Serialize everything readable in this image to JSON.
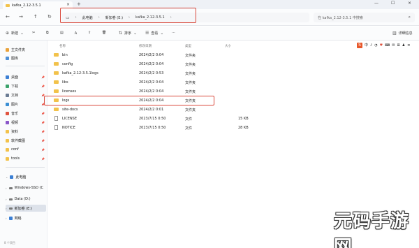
{
  "window": {
    "tab_title": "kafka_2.12-3.5.1",
    "close_glyph": "×",
    "new_tab_glyph": "+",
    "minimize_glyph": "—",
    "maximize_glyph": "☐",
    "win_close_glyph": "×"
  },
  "nav": {
    "back": "←",
    "forward": "→",
    "up": "↑",
    "refresh": "↻"
  },
  "address": {
    "crumbs": [
      "此电脑",
      "新加卷 (E:)",
      "kafka_2.12-3.5.1"
    ],
    "separator": "›",
    "search_placeholder": "在 kafka_2.12-3.5.1 中搜索"
  },
  "toolbar": {
    "new_label": "新建",
    "sort_label": "排序",
    "view_label": "查看",
    "more_label": "···",
    "details_label": "详细信息"
  },
  "sidebar": {
    "items": [
      {
        "label": "主文件夹",
        "color": "#e9a23b"
      },
      {
        "label": "图库",
        "color": "#4d8fd6"
      },
      {
        "label": "桌面",
        "color": "#3b7fd4"
      },
      {
        "label": "下载",
        "color": "#3aa26a"
      },
      {
        "label": "文档",
        "color": "#6a7b93"
      },
      {
        "label": "图片",
        "color": "#3b8fd4"
      },
      {
        "label": "音乐",
        "color": "#e0533f"
      },
      {
        "label": "视频",
        "color": "#8a56c9"
      },
      {
        "label": "资料",
        "color": "#f2c24b"
      },
      {
        "label": "软件截图",
        "color": "#f2c24b"
      },
      {
        "label": "conf",
        "color": "#f2c24b"
      },
      {
        "label": "tools",
        "color": "#f2c24b"
      },
      {
        "label": "此电脑",
        "color": "#3b7fd4"
      },
      {
        "label": "Windows-SSD (C",
        "color": "#777777"
      },
      {
        "label": "Data (D:)",
        "color": "#777777"
      },
      {
        "label": "新加卷 (E:)",
        "color": "#777777"
      },
      {
        "label": "网络",
        "color": "#3b7fd4"
      }
    ],
    "status": "8 个项目"
  },
  "columns": {
    "name": "名称",
    "modified": "修改日期",
    "type": "类型",
    "size": "大小"
  },
  "files": [
    {
      "name": "bin",
      "modified": "2024/2/2 0:04",
      "type": "文件夹",
      "size": "",
      "kind": "folder"
    },
    {
      "name": "config",
      "modified": "2024/2/2 0:04",
      "type": "文件夹",
      "size": "",
      "kind": "folder"
    },
    {
      "name": "kafka_2.12-3.5.1logs",
      "modified": "2024/2/2 0:53",
      "type": "文件夹",
      "size": "",
      "kind": "folder"
    },
    {
      "name": "libs",
      "modified": "2024/2/2 0:04",
      "type": "文件夹",
      "size": "",
      "kind": "folder"
    },
    {
      "name": "licenses",
      "modified": "2024/2/2 0:04",
      "type": "文件夹",
      "size": "",
      "kind": "folder"
    },
    {
      "name": "logs",
      "modified": "2024/2/2 0:04",
      "type": "文件夹",
      "size": "",
      "kind": "folder"
    },
    {
      "name": "site-docs",
      "modified": "2024/2/2 0:01",
      "type": "文件夹",
      "size": "",
      "kind": "folder"
    },
    {
      "name": "LICENSE",
      "modified": "2023/7/15 0:50",
      "type": "文件",
      "size": "15 KB",
      "kind": "file"
    },
    {
      "name": "NOTICE",
      "modified": "2023/7/15 0:50",
      "type": "文件",
      "size": "28 KB",
      "kind": "file"
    }
  ],
  "ime": {
    "logo": "S",
    "mode": "中",
    "items": [
      "♪",
      "◔",
      "♥",
      "⌨",
      "✉",
      "⊞",
      "♟",
      "≡"
    ]
  },
  "watermark": {
    "text": "元码手游网"
  },
  "colors": {
    "highlight": "#d9483b",
    "folder": "#f2c24b"
  }
}
